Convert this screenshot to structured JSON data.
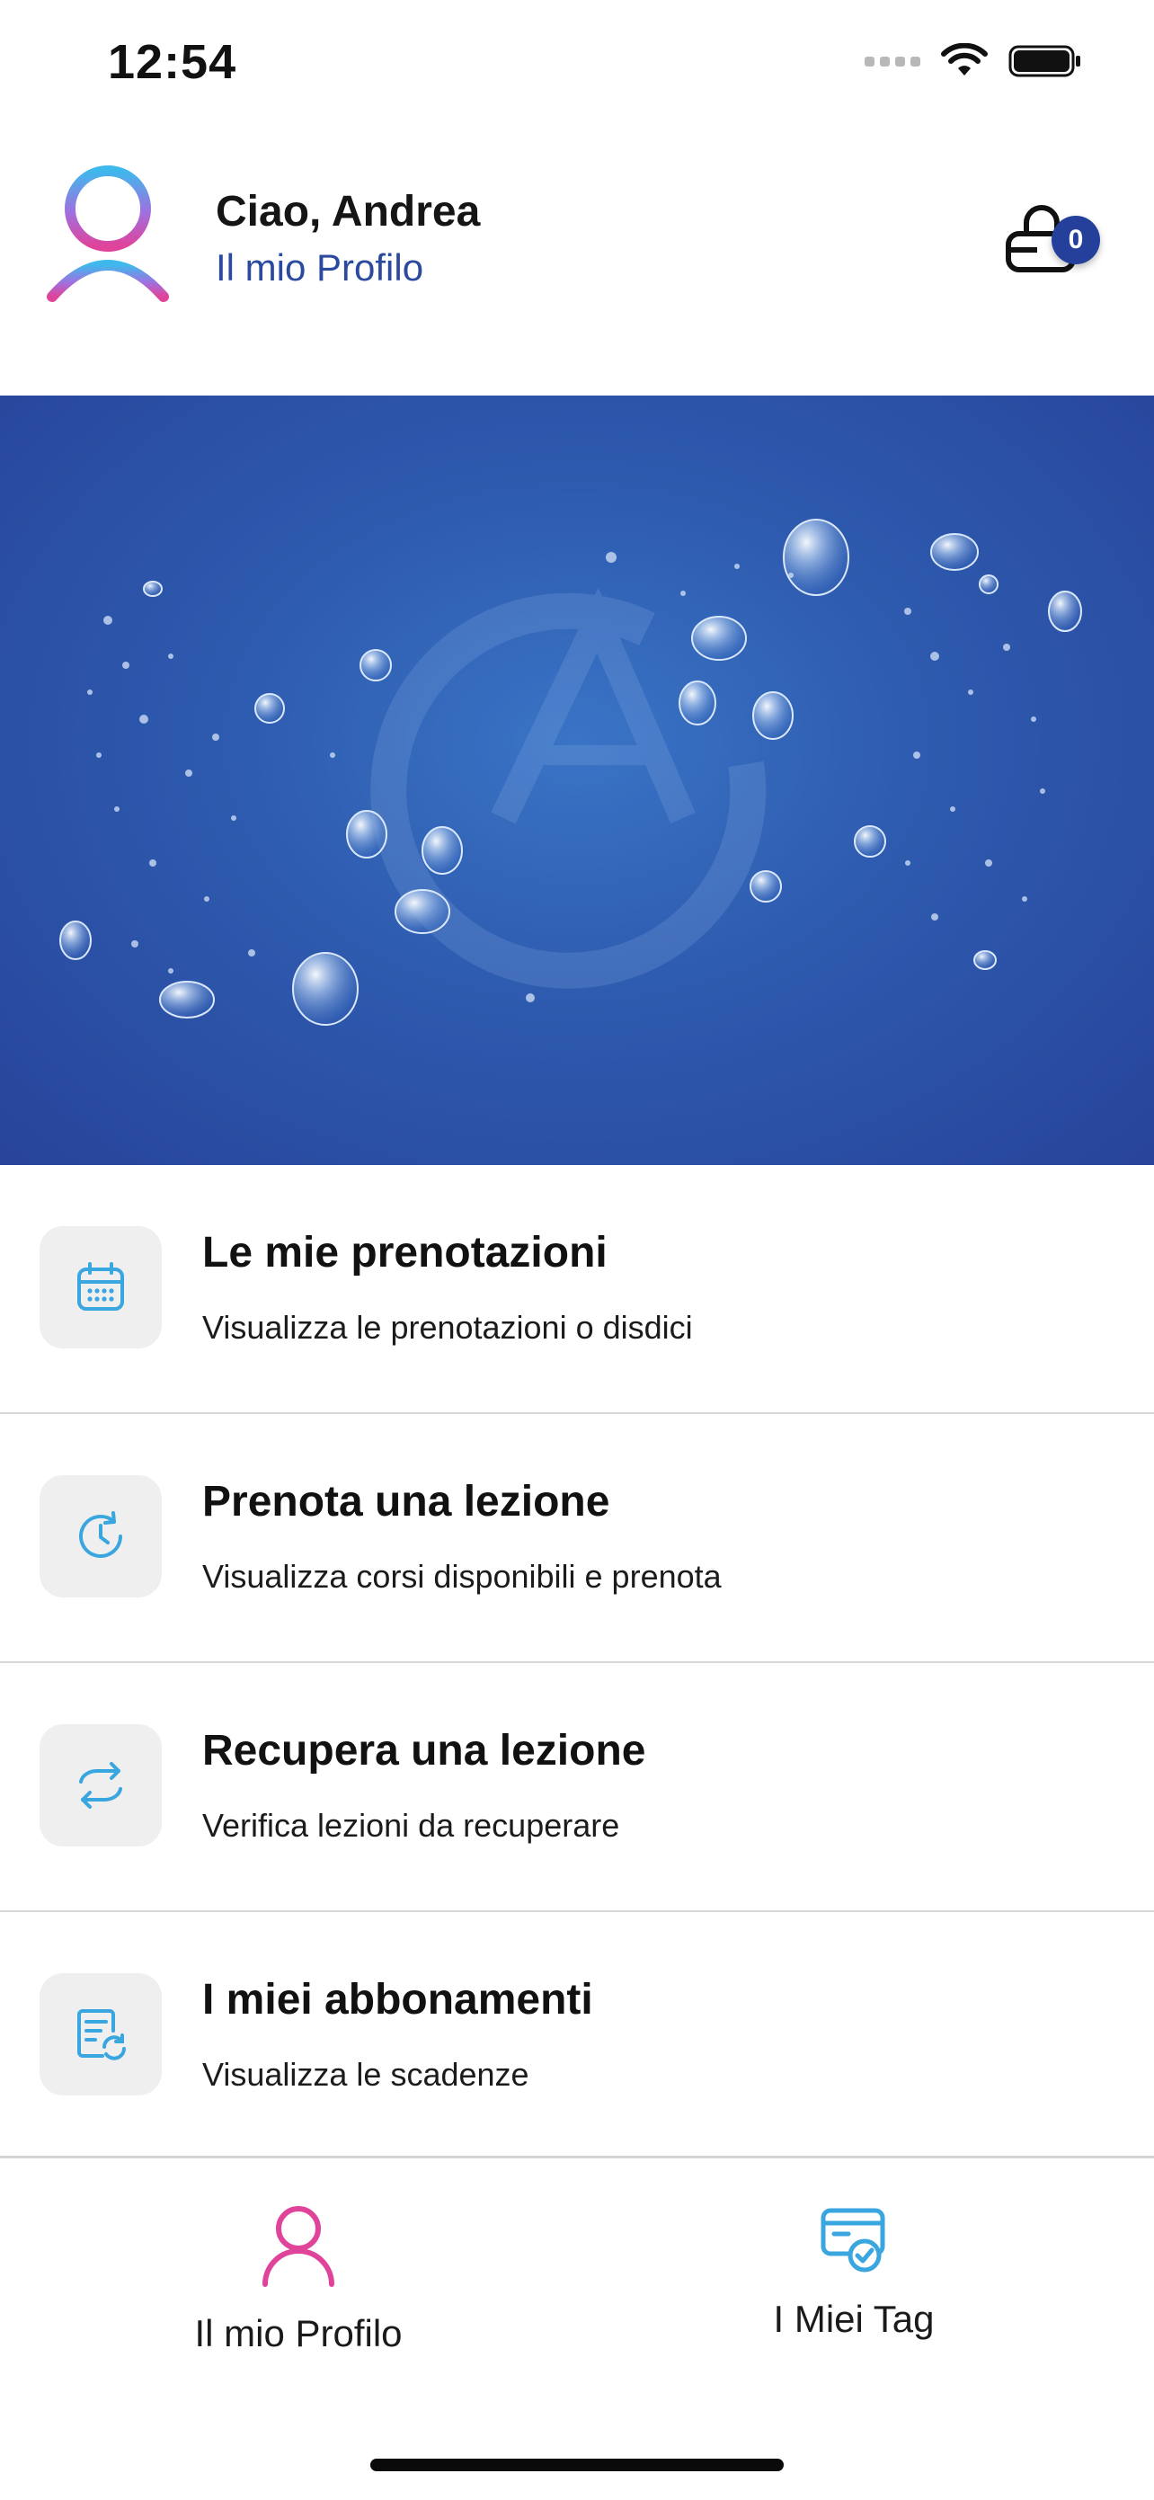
{
  "status_bar": {
    "time": "12:54"
  },
  "header": {
    "greeting": "Ciao, Andrea",
    "profile_link": "Il mio Profilo",
    "cart_count": "0"
  },
  "menu": {
    "items": [
      {
        "title": "Le mie prenotazioni",
        "subtitle": "Visualizza le prenotazioni o disdici",
        "icon": "calendar-icon"
      },
      {
        "title": "Prenota una lezione",
        "subtitle": "Visualizza corsi disponibili e prenota",
        "icon": "clock-refresh-icon"
      },
      {
        "title": "Recupera una lezione",
        "subtitle": "Verifica lezioni da recuperare",
        "icon": "sync-icon"
      },
      {
        "title": "I miei abbonamenti",
        "subtitle": "Visualizza le scadenze",
        "icon": "subscription-icon"
      }
    ]
  },
  "tabbar": {
    "tabs": [
      {
        "label": "Il mio Profilo",
        "icon": "person-icon"
      },
      {
        "label": "I Miei Tag",
        "icon": "card-check-icon"
      }
    ]
  },
  "colors": {
    "accent_blue": "#24409a",
    "link_blue": "#2b4a9f",
    "icon_cyan": "#3aa6df",
    "profile_pink": "#e0439a"
  }
}
